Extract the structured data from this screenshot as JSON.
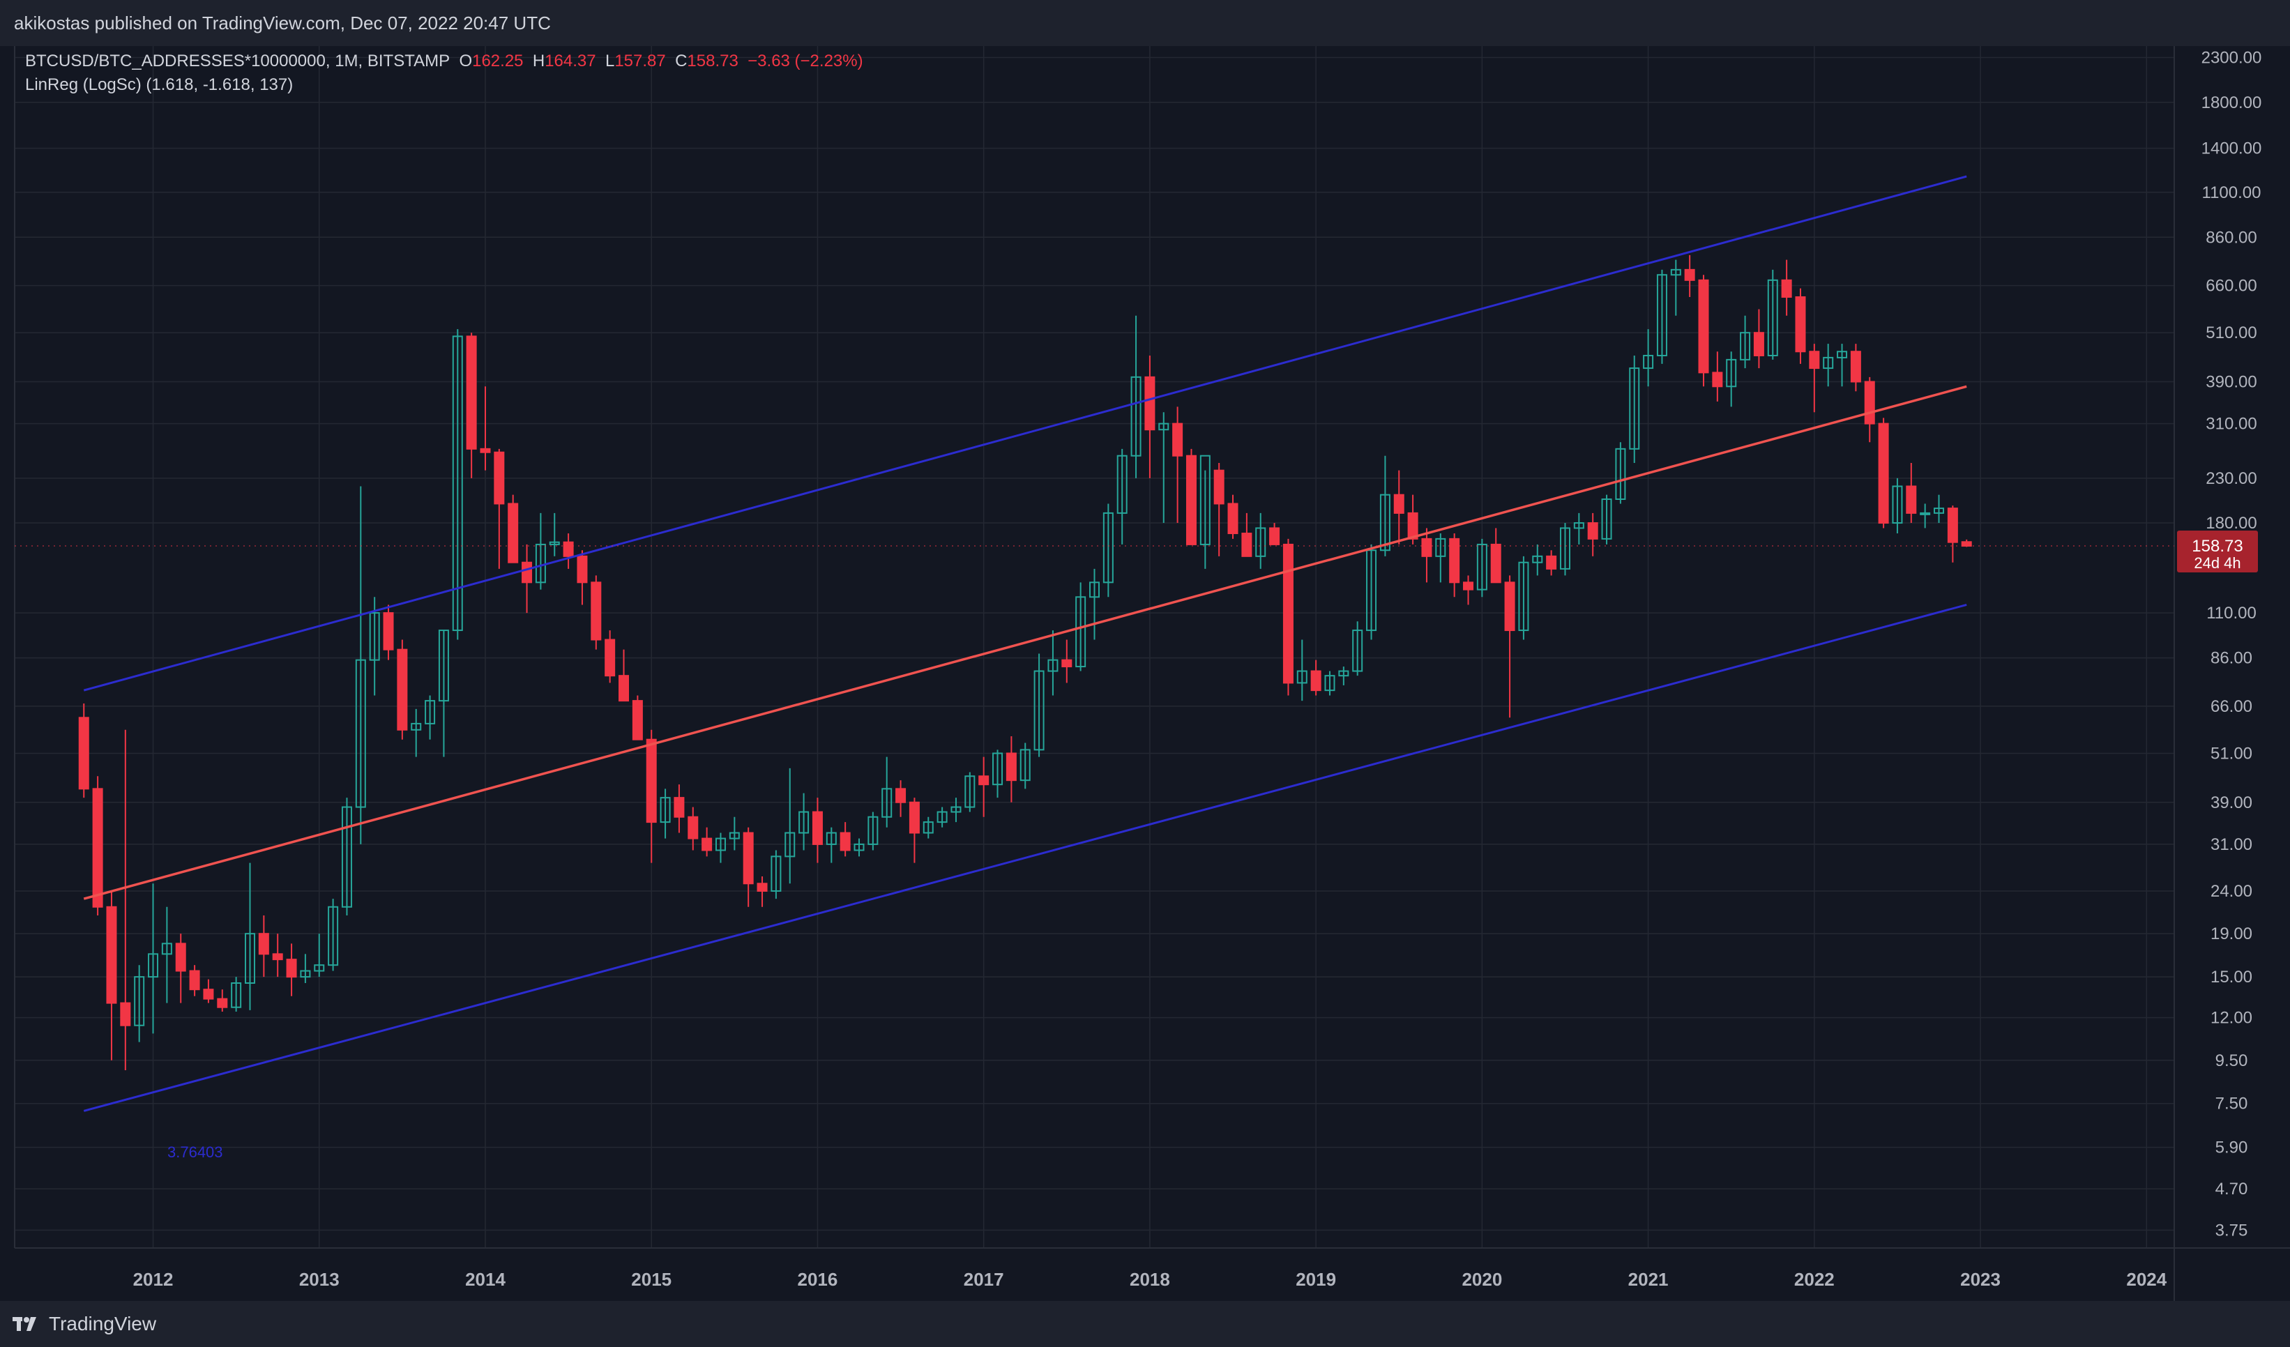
{
  "header": {
    "text": "akikostas published on TradingView.com, Dec 07, 2022 20:47 UTC"
  },
  "legend": {
    "symbol": "BTCUSD/BTC_ADDRESSES*10000000, 1M, BITSTAMP",
    "o_label": "O",
    "o": "162.25",
    "h_label": "H",
    "h": "164.37",
    "l_label": "L",
    "l": "157.87",
    "c_label": "C",
    "c": "158.73",
    "change": "−3.63 (−2.23%)",
    "indicator": "LinReg (LogSc) (1.618, -1.618, 137)"
  },
  "footer": {
    "brand": "TradingView"
  },
  "colors": {
    "background": "#131722",
    "grid": "#242833",
    "up": "#26a69a",
    "down": "#f23645",
    "regression": "#f05350",
    "channel": "#2c2ccf",
    "text": "#b2b5be",
    "price_tag": "#a7232d"
  },
  "chart_data": {
    "type": "candlestick",
    "scale": "log",
    "ylim": [
      3.4,
      2450
    ],
    "xlim": [
      "2011-03",
      "2024-03"
    ],
    "x_ticks": [
      "2012",
      "2013",
      "2014",
      "2015",
      "2016",
      "2017",
      "2018",
      "2019",
      "2020",
      "2021",
      "2022",
      "2023",
      "2024"
    ],
    "y_ticks": [
      3.75,
      4.7,
      5.9,
      7.5,
      9.5,
      12.0,
      15.0,
      19.0,
      24.0,
      31.0,
      39.0,
      51.0,
      66.0,
      86.0,
      110.0,
      180.0,
      230.0,
      310.0,
      390.0,
      510.0,
      660.0,
      860.0,
      1100.0,
      1400.0,
      1800.0,
      2300.0
    ],
    "last_price": "158.73",
    "countdown": "24d 4h",
    "channel_label": "3.76403",
    "regression": {
      "start": "2011-08",
      "end": "2022-12",
      "mid": [
        23,
        380
      ],
      "upper": [
        72,
        1200
      ],
      "lower": [
        7.2,
        115
      ]
    },
    "candles": [
      [
        "2011-08",
        62,
        67,
        40,
        42
      ],
      [
        "2011-09",
        42,
        45,
        21,
        22
      ],
      [
        "2011-10",
        22,
        24,
        9.5,
        13
      ],
      [
        "2011-11",
        13,
        58,
        9,
        11.5
      ],
      [
        "2011-12",
        11.5,
        16,
        10.5,
        15
      ],
      [
        "2012-01",
        15,
        25,
        11,
        17
      ],
      [
        "2012-02",
        17,
        22,
        13,
        18
      ],
      [
        "2012-03",
        18,
        19,
        13,
        15.5
      ],
      [
        "2012-04",
        15.5,
        16,
        13.5,
        14
      ],
      [
        "2012-05",
        14,
        14.8,
        13,
        13.3
      ],
      [
        "2012-06",
        13.3,
        14,
        12.4,
        12.7
      ],
      [
        "2012-07",
        12.7,
        15,
        12.4,
        14.5
      ],
      [
        "2012-08",
        14.5,
        28,
        12.5,
        19
      ],
      [
        "2012-09",
        19,
        21,
        15,
        17
      ],
      [
        "2012-10",
        17,
        19,
        15,
        16.5
      ],
      [
        "2012-11",
        16.5,
        18,
        13.5,
        15
      ],
      [
        "2012-12",
        15,
        17,
        14.5,
        15.5
      ],
      [
        "2013-01",
        15.5,
        19,
        15,
        16
      ],
      [
        "2013-02",
        16,
        23,
        15.5,
        22
      ],
      [
        "2013-03",
        22,
        40,
        21,
        38
      ],
      [
        "2013-04",
        38,
        220,
        31,
        85
      ],
      [
        "2013-05",
        85,
        120,
        70,
        110
      ],
      [
        "2013-06",
        110,
        115,
        85,
        90
      ],
      [
        "2013-07",
        90,
        95,
        55,
        58
      ],
      [
        "2013-08",
        58,
        65,
        50,
        60
      ],
      [
        "2013-09",
        60,
        70,
        55,
        68
      ],
      [
        "2013-10",
        68,
        100,
        50,
        100
      ],
      [
        "2013-11",
        100,
        520,
        95,
        500
      ],
      [
        "2013-12",
        500,
        510,
        230,
        270
      ],
      [
        "2014-01",
        270,
        380,
        240,
        265
      ],
      [
        "2014-02",
        265,
        270,
        140,
        200
      ],
      [
        "2014-03",
        200,
        210,
        145,
        145
      ],
      [
        "2014-04",
        145,
        160,
        110,
        130
      ],
      [
        "2014-05",
        130,
        190,
        125,
        160
      ],
      [
        "2014-06",
        160,
        190,
        150,
        162
      ],
      [
        "2014-07",
        162,
        170,
        140,
        150
      ],
      [
        "2014-08",
        150,
        155,
        115,
        130
      ],
      [
        "2014-09",
        130,
        135,
        90,
        95
      ],
      [
        "2014-10",
        95,
        100,
        75,
        78
      ],
      [
        "2014-11",
        78,
        90,
        70,
        68
      ],
      [
        "2014-12",
        68,
        70,
        55,
        55
      ],
      [
        "2015-01",
        55,
        58,
        28,
        35
      ],
      [
        "2015-02",
        35,
        42,
        32,
        40
      ],
      [
        "2015-03",
        40,
        43,
        33,
        36
      ],
      [
        "2015-04",
        36,
        38,
        30,
        32
      ],
      [
        "2015-05",
        32,
        34,
        29,
        30
      ],
      [
        "2015-06",
        30,
        33,
        28,
        32
      ],
      [
        "2015-07",
        32,
        36,
        30,
        33
      ],
      [
        "2015-08",
        33,
        34,
        22,
        25
      ],
      [
        "2015-09",
        25,
        26,
        22,
        24
      ],
      [
        "2015-10",
        24,
        30,
        23,
        29
      ],
      [
        "2015-11",
        29,
        47,
        25,
        33
      ],
      [
        "2015-12",
        33,
        41,
        30,
        37
      ],
      [
        "2016-01",
        37,
        40,
        28,
        31
      ],
      [
        "2016-02",
        31,
        34,
        28,
        33
      ],
      [
        "2016-03",
        33,
        35,
        29,
        30
      ],
      [
        "2016-04",
        30,
        32,
        29,
        31
      ],
      [
        "2016-05",
        31,
        37,
        30,
        36
      ],
      [
        "2016-06",
        36,
        50,
        34,
        42
      ],
      [
        "2016-07",
        42,
        44,
        36,
        39
      ],
      [
        "2016-08",
        39,
        40,
        28,
        33
      ],
      [
        "2016-09",
        33,
        36,
        32,
        35
      ],
      [
        "2016-10",
        35,
        38,
        34,
        37
      ],
      [
        "2016-11",
        37,
        40,
        35,
        38
      ],
      [
        "2016-12",
        38,
        46,
        37,
        45
      ],
      [
        "2017-01",
        45,
        50,
        36,
        43
      ],
      [
        "2017-02",
        43,
        52,
        40,
        51
      ],
      [
        "2017-03",
        51,
        56,
        39,
        44
      ],
      [
        "2017-04",
        44,
        54,
        42,
        52
      ],
      [
        "2017-05",
        52,
        88,
        50,
        80
      ],
      [
        "2017-06",
        80,
        100,
        70,
        85
      ],
      [
        "2017-07",
        85,
        95,
        75,
        82
      ],
      [
        "2017-08",
        82,
        130,
        80,
        120
      ],
      [
        "2017-09",
        120,
        140,
        95,
        130
      ],
      [
        "2017-10",
        130,
        200,
        120,
        190
      ],
      [
        "2017-11",
        190,
        270,
        160,
        260
      ],
      [
        "2017-12",
        260,
        560,
        230,
        400
      ],
      [
        "2018-01",
        400,
        450,
        230,
        300
      ],
      [
        "2018-02",
        300,
        330,
        180,
        310
      ],
      [
        "2018-03",
        310,
        340,
        180,
        260
      ],
      [
        "2018-04",
        260,
        270,
        160,
        160
      ],
      [
        "2018-05",
        160,
        240,
        140,
        260
      ],
      [
        "2018-06",
        240,
        250,
        150,
        200
      ],
      [
        "2018-07",
        200,
        210,
        165,
        170
      ],
      [
        "2018-08",
        170,
        190,
        150,
        150
      ],
      [
        "2018-09",
        150,
        190,
        140,
        175
      ],
      [
        "2018-10",
        175,
        180,
        160,
        160
      ],
      [
        "2018-11",
        160,
        165,
        70,
        75
      ],
      [
        "2018-12",
        75,
        95,
        68,
        80
      ],
      [
        "2019-01",
        80,
        85,
        70,
        72
      ],
      [
        "2019-02",
        72,
        80,
        70,
        78
      ],
      [
        "2019-03",
        78,
        82,
        74,
        80
      ],
      [
        "2019-04",
        80,
        105,
        78,
        100
      ],
      [
        "2019-05",
        100,
        160,
        95,
        155
      ],
      [
        "2019-06",
        155,
        260,
        150,
        210
      ],
      [
        "2019-07",
        210,
        240,
        160,
        190
      ],
      [
        "2019-08",
        190,
        210,
        160,
        165
      ],
      [
        "2019-09",
        165,
        175,
        130,
        150
      ],
      [
        "2019-10",
        150,
        170,
        130,
        165
      ],
      [
        "2019-11",
        165,
        170,
        120,
        130
      ],
      [
        "2019-12",
        130,
        135,
        115,
        125
      ],
      [
        "2020-01",
        125,
        165,
        120,
        160
      ],
      [
        "2020-02",
        160,
        175,
        140,
        130
      ],
      [
        "2020-03",
        130,
        135,
        62,
        100
      ],
      [
        "2020-04",
        100,
        150,
        95,
        145
      ],
      [
        "2020-05",
        145,
        160,
        135,
        150
      ],
      [
        "2020-06",
        150,
        155,
        135,
        140
      ],
      [
        "2020-07",
        140,
        180,
        135,
        175
      ],
      [
        "2020-08",
        175,
        190,
        160,
        180
      ],
      [
        "2020-09",
        180,
        190,
        150,
        165
      ],
      [
        "2020-10",
        165,
        210,
        160,
        205
      ],
      [
        "2020-11",
        205,
        280,
        200,
        270
      ],
      [
        "2020-12",
        270,
        450,
        250,
        420
      ],
      [
        "2021-01",
        420,
        520,
        380,
        450
      ],
      [
        "2021-02",
        450,
        720,
        430,
        700
      ],
      [
        "2021-03",
        700,
        760,
        560,
        720
      ],
      [
        "2021-04",
        720,
        780,
        620,
        680
      ],
      [
        "2021-05",
        680,
        700,
        380,
        410
      ],
      [
        "2021-06",
        410,
        460,
        350,
        380
      ],
      [
        "2021-07",
        380,
        460,
        340,
        440
      ],
      [
        "2021-08",
        440,
        560,
        420,
        510
      ],
      [
        "2021-09",
        510,
        580,
        420,
        450
      ],
      [
        "2021-10",
        450,
        720,
        440,
        680
      ],
      [
        "2021-11",
        680,
        760,
        560,
        620
      ],
      [
        "2021-12",
        620,
        650,
        430,
        460
      ],
      [
        "2022-01",
        460,
        480,
        330,
        420
      ],
      [
        "2022-02",
        420,
        480,
        380,
        445
      ],
      [
        "2022-03",
        445,
        480,
        380,
        460
      ],
      [
        "2022-04",
        460,
        480,
        370,
        390
      ],
      [
        "2022-05",
        390,
        400,
        280,
        310
      ],
      [
        "2022-06",
        310,
        320,
        175,
        180
      ],
      [
        "2022-07",
        180,
        230,
        170,
        220
      ],
      [
        "2022-08",
        220,
        250,
        180,
        190
      ],
      [
        "2022-09",
        190,
        200,
        175,
        190
      ],
      [
        "2022-10",
        190,
        210,
        180,
        195
      ],
      [
        "2022-11",
        195,
        198,
        145,
        162
      ],
      [
        "2022-12",
        162.25,
        164.37,
        157.87,
        158.73
      ]
    ]
  }
}
